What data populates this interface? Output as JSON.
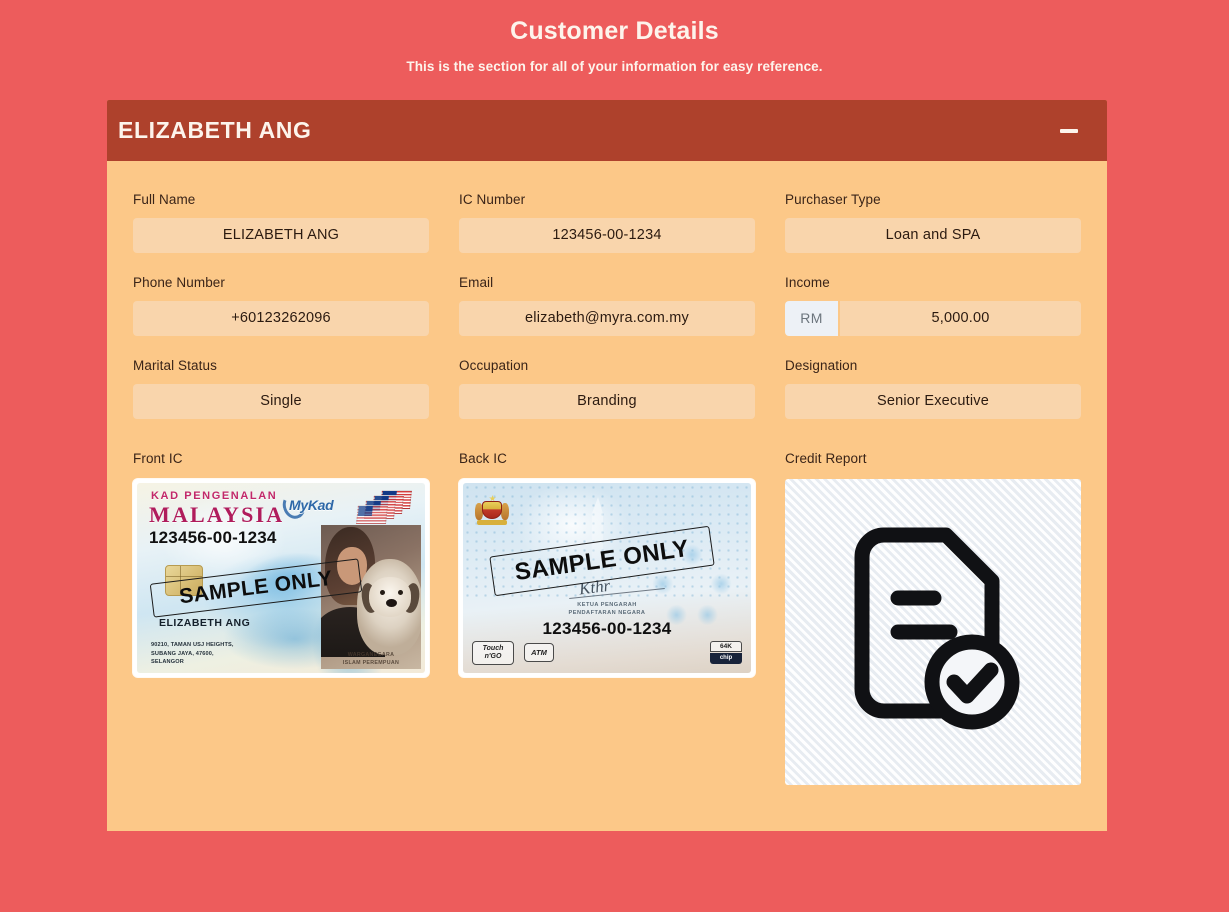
{
  "page": {
    "title": "Customer Details",
    "subtitle": "This is the section for all of your information for easy reference."
  },
  "colors": {
    "page_background": "#ED5C5C",
    "card_header": "#AE412C",
    "card_body": "#FCC888",
    "field_fill": "#F9D5AC",
    "prefix_fill": "#EDF1F6",
    "title_text": "#FDF4EC",
    "label_text": "#3A2418"
  },
  "card": {
    "header": {
      "title": "ELIZABETH ANG",
      "collapse_icon": "minus-icon",
      "collapse_state": "expanded"
    },
    "rows": [
      [
        {
          "label": "Full Name",
          "value": "ELIZABETH ANG",
          "name": "full-name"
        },
        {
          "label": "IC Number",
          "value": "123456-00-1234",
          "name": "ic-number"
        },
        {
          "label": "Purchaser Type",
          "value": "Loan and SPA",
          "name": "purchaser-type"
        }
      ],
      [
        {
          "label": "Phone Number",
          "value": "+60123262096",
          "name": "phone-number"
        },
        {
          "label": "Email",
          "value": "elizabeth@myra.com.my",
          "name": "email"
        },
        {
          "label": "Income",
          "value": "5,000.00",
          "prefix": "RM",
          "name": "income"
        }
      ],
      [
        {
          "label": "Marital Status",
          "value": "Single",
          "name": "marital-status"
        },
        {
          "label": "Occupation",
          "value": "Branding",
          "name": "occupation"
        },
        {
          "label": "Designation",
          "value": "Senior Executive",
          "name": "designation"
        }
      ]
    ],
    "attachments": [
      {
        "label": "Front IC",
        "name": "front-ic",
        "kind": "ic-front"
      },
      {
        "label": "Back IC",
        "name": "back-ic",
        "kind": "ic-back"
      },
      {
        "label": "Credit Report",
        "name": "credit-report",
        "kind": "document",
        "icon": "document-check-icon"
      }
    ]
  },
  "ic_front": {
    "header_line1": "KAD PENGENALAN",
    "header_line2": "MALAYSIA",
    "brand": "MyKad",
    "ic_number": "123456-00-1234",
    "holder_name": "ELIZABETH ANG",
    "address_line1": "90210, TAMAN USJ HEIGHTS,",
    "address_line2": "SUBANG JAYA, 47600,",
    "address_line3": "SELANGOR",
    "watermark": "SAMPLE ONLY",
    "photo_caption_line1": "WARGANEGARA",
    "photo_caption_line2": "ISLAM          PEREMPUAN"
  },
  "ic_back": {
    "watermark": "SAMPLE ONLY",
    "authority_line1": "KETUA PENGARAH",
    "authority_line2": "PENDAFTARAN NEGARA",
    "ic_number": "123456-00-1234",
    "badges": {
      "touch_n_go_line1": "Touch",
      "touch_n_go_line2": "n'GO",
      "atm": "ATM",
      "chip_top": "64K",
      "chip_bottom": "chip"
    }
  }
}
